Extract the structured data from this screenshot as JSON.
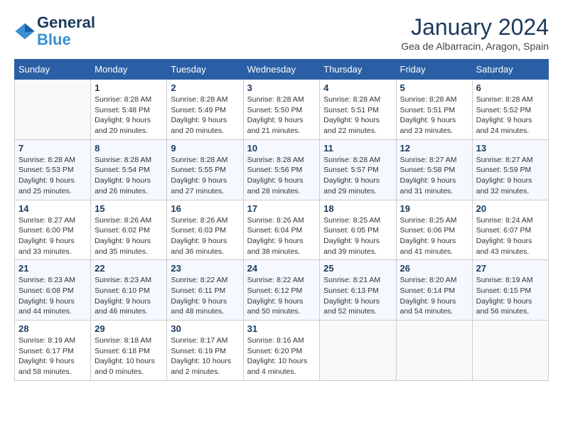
{
  "header": {
    "logo_line1": "General",
    "logo_line2": "Blue",
    "month_title": "January 2024",
    "subtitle": "Gea de Albarracin, Aragon, Spain"
  },
  "days_of_week": [
    "Sunday",
    "Monday",
    "Tuesday",
    "Wednesday",
    "Thursday",
    "Friday",
    "Saturday"
  ],
  "weeks": [
    [
      {
        "day": "",
        "info": ""
      },
      {
        "day": "1",
        "info": "Sunrise: 8:28 AM\nSunset: 5:48 PM\nDaylight: 9 hours\nand 20 minutes."
      },
      {
        "day": "2",
        "info": "Sunrise: 8:28 AM\nSunset: 5:49 PM\nDaylight: 9 hours\nand 20 minutes."
      },
      {
        "day": "3",
        "info": "Sunrise: 8:28 AM\nSunset: 5:50 PM\nDaylight: 9 hours\nand 21 minutes."
      },
      {
        "day": "4",
        "info": "Sunrise: 8:28 AM\nSunset: 5:51 PM\nDaylight: 9 hours\nand 22 minutes."
      },
      {
        "day": "5",
        "info": "Sunrise: 8:28 AM\nSunset: 5:51 PM\nDaylight: 9 hours\nand 23 minutes."
      },
      {
        "day": "6",
        "info": "Sunrise: 8:28 AM\nSunset: 5:52 PM\nDaylight: 9 hours\nand 24 minutes."
      }
    ],
    [
      {
        "day": "7",
        "info": "Sunrise: 8:28 AM\nSunset: 5:53 PM\nDaylight: 9 hours\nand 25 minutes."
      },
      {
        "day": "8",
        "info": "Sunrise: 8:28 AM\nSunset: 5:54 PM\nDaylight: 9 hours\nand 26 minutes."
      },
      {
        "day": "9",
        "info": "Sunrise: 8:28 AM\nSunset: 5:55 PM\nDaylight: 9 hours\nand 27 minutes."
      },
      {
        "day": "10",
        "info": "Sunrise: 8:28 AM\nSunset: 5:56 PM\nDaylight: 9 hours\nand 28 minutes."
      },
      {
        "day": "11",
        "info": "Sunrise: 8:28 AM\nSunset: 5:57 PM\nDaylight: 9 hours\nand 29 minutes."
      },
      {
        "day": "12",
        "info": "Sunrise: 8:27 AM\nSunset: 5:58 PM\nDaylight: 9 hours\nand 31 minutes."
      },
      {
        "day": "13",
        "info": "Sunrise: 8:27 AM\nSunset: 5:59 PM\nDaylight: 9 hours\nand 32 minutes."
      }
    ],
    [
      {
        "day": "14",
        "info": "Sunrise: 8:27 AM\nSunset: 6:00 PM\nDaylight: 9 hours\nand 33 minutes."
      },
      {
        "day": "15",
        "info": "Sunrise: 8:26 AM\nSunset: 6:02 PM\nDaylight: 9 hours\nand 35 minutes."
      },
      {
        "day": "16",
        "info": "Sunrise: 8:26 AM\nSunset: 6:03 PM\nDaylight: 9 hours\nand 36 minutes."
      },
      {
        "day": "17",
        "info": "Sunrise: 8:26 AM\nSunset: 6:04 PM\nDaylight: 9 hours\nand 38 minutes."
      },
      {
        "day": "18",
        "info": "Sunrise: 8:25 AM\nSunset: 6:05 PM\nDaylight: 9 hours\nand 39 minutes."
      },
      {
        "day": "19",
        "info": "Sunrise: 8:25 AM\nSunset: 6:06 PM\nDaylight: 9 hours\nand 41 minutes."
      },
      {
        "day": "20",
        "info": "Sunrise: 8:24 AM\nSunset: 6:07 PM\nDaylight: 9 hours\nand 43 minutes."
      }
    ],
    [
      {
        "day": "21",
        "info": "Sunrise: 8:23 AM\nSunset: 6:08 PM\nDaylight: 9 hours\nand 44 minutes."
      },
      {
        "day": "22",
        "info": "Sunrise: 8:23 AM\nSunset: 6:10 PM\nDaylight: 9 hours\nand 46 minutes."
      },
      {
        "day": "23",
        "info": "Sunrise: 8:22 AM\nSunset: 6:11 PM\nDaylight: 9 hours\nand 48 minutes."
      },
      {
        "day": "24",
        "info": "Sunrise: 8:22 AM\nSunset: 6:12 PM\nDaylight: 9 hours\nand 50 minutes."
      },
      {
        "day": "25",
        "info": "Sunrise: 8:21 AM\nSunset: 6:13 PM\nDaylight: 9 hours\nand 52 minutes."
      },
      {
        "day": "26",
        "info": "Sunrise: 8:20 AM\nSunset: 6:14 PM\nDaylight: 9 hours\nand 54 minutes."
      },
      {
        "day": "27",
        "info": "Sunrise: 8:19 AM\nSunset: 6:15 PM\nDaylight: 9 hours\nand 56 minutes."
      }
    ],
    [
      {
        "day": "28",
        "info": "Sunrise: 8:19 AM\nSunset: 6:17 PM\nDaylight: 9 hours\nand 58 minutes."
      },
      {
        "day": "29",
        "info": "Sunrise: 8:18 AM\nSunset: 6:18 PM\nDaylight: 10 hours\nand 0 minutes."
      },
      {
        "day": "30",
        "info": "Sunrise: 8:17 AM\nSunset: 6:19 PM\nDaylight: 10 hours\nand 2 minutes."
      },
      {
        "day": "31",
        "info": "Sunrise: 8:16 AM\nSunset: 6:20 PM\nDaylight: 10 hours\nand 4 minutes."
      },
      {
        "day": "",
        "info": ""
      },
      {
        "day": "",
        "info": ""
      },
      {
        "day": "",
        "info": ""
      }
    ]
  ]
}
